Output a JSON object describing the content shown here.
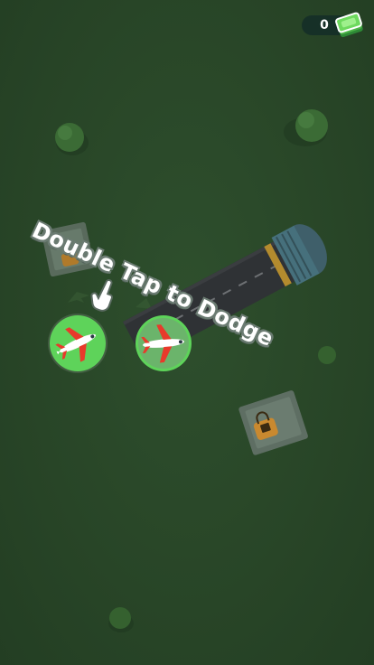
{
  "hud": {
    "currency_count": "0",
    "currency_icon": "cash-stack-icon"
  },
  "tutorial": {
    "text": "Double Tap to Dodge",
    "hand_icon": "pointing-hand-icon"
  },
  "colors": {
    "ground": "#294829",
    "plane_disc": "#5ed35a",
    "plane_body": "#ffffff",
    "plane_accent": "#e83a2b",
    "runway": "#2d3033",
    "cash_green": "#5fcf4f"
  }
}
